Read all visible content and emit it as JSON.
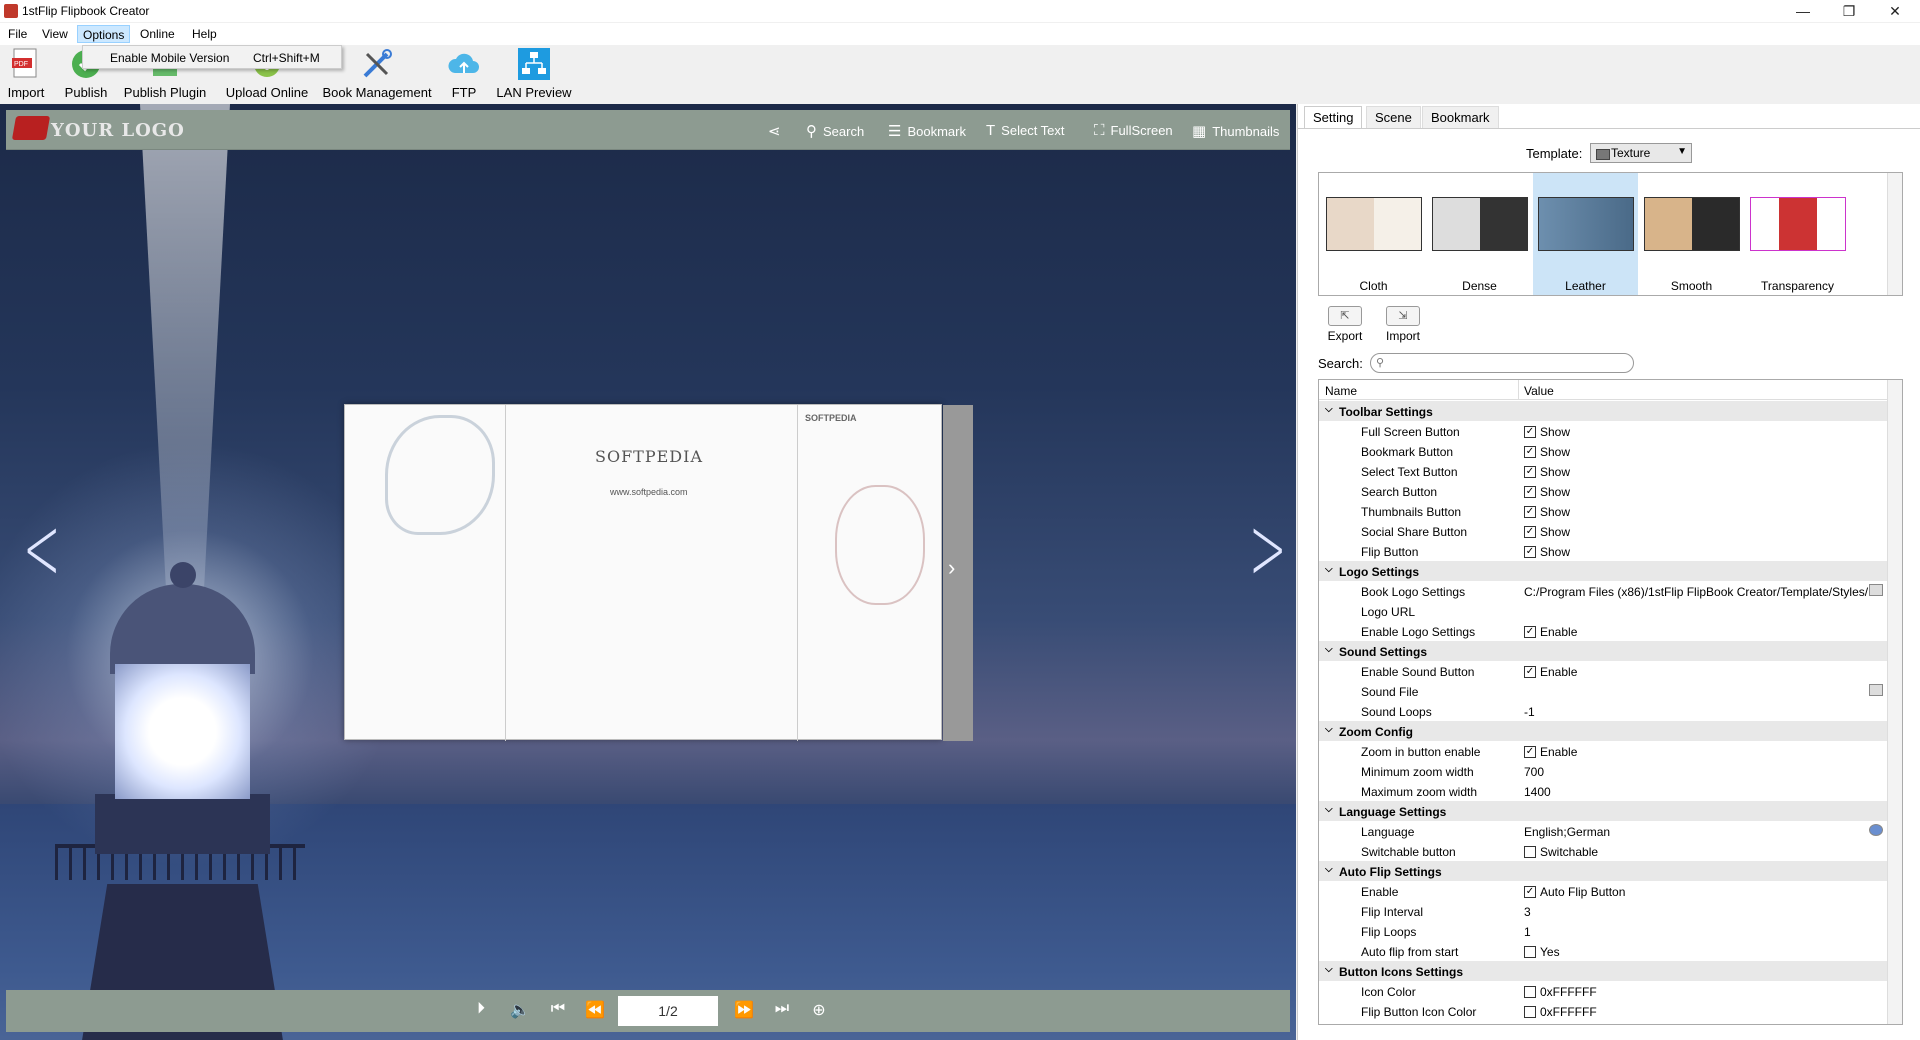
{
  "window": {
    "title": "1stFlip Flipbook Creator"
  },
  "menu": {
    "items": [
      "File",
      "View",
      "Options",
      "Online",
      "Help"
    ],
    "active": "Options"
  },
  "dropdown": {
    "label": "Enable Mobile Version",
    "shortcut": "Ctrl+Shift+M"
  },
  "toolbar": {
    "import": "Import",
    "publish": "Publish",
    "publish_plugin": "Publish Plugin",
    "upload_online": "Upload Online",
    "book_management": "Book Management",
    "ftp": "FTP",
    "lan_preview": "LAN Preview"
  },
  "viewer": {
    "logo": "YOUR LOGO",
    "search": "Search",
    "bookmark": "Bookmark",
    "select_text": "Select Text",
    "fullscreen": "FullScreen",
    "thumbnails": "Thumbnails",
    "page_brand": "SOFTPEDIA",
    "page_url": "www.softpedia.com",
    "page_indicator": "1/2"
  },
  "panel": {
    "tabs": [
      "Setting",
      "Scene",
      "Bookmark"
    ],
    "active_tab": "Setting",
    "template_label": "Template:",
    "template_value": "Texture",
    "templates": [
      "Cloth",
      "Dense",
      "Leather",
      "Smooth",
      "Transparency"
    ],
    "selected_template": "Leather",
    "export": "Export",
    "import": "Import",
    "search_label": "Search:",
    "search_placeholder": "",
    "col_name": "Name",
    "col_value": "Value"
  },
  "settings": [
    {
      "category": "Toolbar Settings",
      "items": [
        {
          "name": "Full Screen Button",
          "value": "Show",
          "checkbox": true,
          "checked": true
        },
        {
          "name": "Bookmark Button",
          "value": "Show",
          "checkbox": true,
          "checked": true
        },
        {
          "name": "Select Text Button",
          "value": "Show",
          "checkbox": true,
          "checked": true
        },
        {
          "name": "Search Button",
          "value": "Show",
          "checkbox": true,
          "checked": true
        },
        {
          "name": "Thumbnails Button",
          "value": "Show",
          "checkbox": true,
          "checked": true
        },
        {
          "name": "Social Share Button",
          "value": "Show",
          "checkbox": true,
          "checked": true
        },
        {
          "name": "Flip Button",
          "value": "Show",
          "checkbox": true,
          "checked": true
        }
      ]
    },
    {
      "category": "Logo Settings",
      "items": [
        {
          "name": "Book Logo Settings",
          "value": "C:/Program Files (x86)/1stFlip FlipBook Creator/Template/Styles/",
          "checkbox": false
        },
        {
          "name": "Logo URL",
          "value": "",
          "checkbox": false
        },
        {
          "name": "Enable Logo Settings",
          "value": "Enable",
          "checkbox": true,
          "checked": true
        }
      ]
    },
    {
      "category": "Sound Settings",
      "items": [
        {
          "name": "Enable Sound Button",
          "value": "Enable",
          "checkbox": true,
          "checked": true
        },
        {
          "name": "Sound File",
          "value": "",
          "checkbox": false
        },
        {
          "name": "Sound Loops",
          "value": "-1",
          "checkbox": false
        }
      ]
    },
    {
      "category": "Zoom Config",
      "items": [
        {
          "name": "Zoom in button enable",
          "value": "Enable",
          "checkbox": true,
          "checked": true
        },
        {
          "name": "Minimum zoom width",
          "value": "700",
          "checkbox": false
        },
        {
          "name": "Maximum zoom width",
          "value": "1400",
          "checkbox": false
        }
      ]
    },
    {
      "category": "Language Settings",
      "items": [
        {
          "name": "Language",
          "value": "English;German",
          "checkbox": false
        },
        {
          "name": "Switchable button",
          "value": "Switchable",
          "checkbox": true,
          "checked": false
        }
      ]
    },
    {
      "category": "Auto Flip Settings",
      "items": [
        {
          "name": "Enable",
          "value": "Auto Flip Button",
          "checkbox": true,
          "checked": true
        },
        {
          "name": "Flip Interval",
          "value": "3",
          "checkbox": false
        },
        {
          "name": "Flip Loops",
          "value": "1",
          "checkbox": false
        },
        {
          "name": "Auto flip from start",
          "value": "Yes",
          "checkbox": true,
          "checked": false
        }
      ]
    },
    {
      "category": "Button Icons Settings",
      "items": [
        {
          "name": "Icon Color",
          "value": "0xFFFFFF",
          "checkbox": false,
          "swatch": "#FFFFFF"
        },
        {
          "name": "Flip Button Icon Color",
          "value": "0xFFFFFF",
          "checkbox": false,
          "swatch": "#FFFFFF"
        }
      ]
    }
  ]
}
